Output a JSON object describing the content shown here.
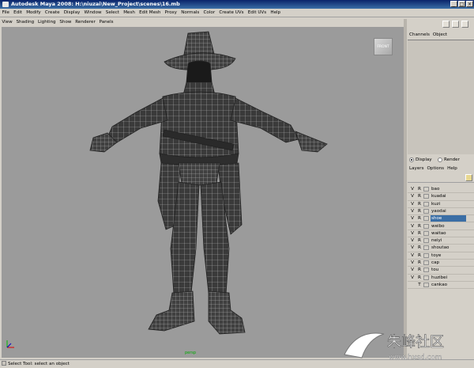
{
  "window": {
    "title": "Autodesk Maya 2008: H:\\niuzai\\New_Project\\scenes\\16.mb",
    "controls": [
      "_",
      "□",
      "×"
    ]
  },
  "menubar": [
    "File",
    "Edit",
    "Modify",
    "Create",
    "Display",
    "Window",
    "Select",
    "Mesh",
    "Edit Mesh",
    "Proxy",
    "Normals",
    "Color",
    "Create UVs",
    "Edit UVs",
    "Help"
  ],
  "panel_menu": [
    "View",
    "Shading",
    "Lighting",
    "Show",
    "Renderer",
    "Panels"
  ],
  "viewport": {
    "viewcube_label": "FRONT",
    "camera_label": "persp",
    "background": "#9b9b9b"
  },
  "channel_box": {
    "tabs": [
      "Channels",
      "Object"
    ]
  },
  "layer_editor": {
    "modes": [
      {
        "label": "Display",
        "selected": true
      },
      {
        "label": "Render",
        "selected": false
      }
    ],
    "menu": [
      "Layers",
      "Options",
      "Help"
    ],
    "layers": [
      {
        "v": "V",
        "r": "R",
        "name": "bao",
        "selected": false
      },
      {
        "v": "V",
        "r": "R",
        "name": "kuadai",
        "selected": false
      },
      {
        "v": "V",
        "r": "R",
        "name": "kuzi",
        "selected": false
      },
      {
        "v": "V",
        "r": "R",
        "name": "yaodai",
        "selected": false
      },
      {
        "v": "V",
        "r": "R",
        "name": "shoe",
        "selected": true
      },
      {
        "v": "V",
        "r": "R",
        "name": "weibo",
        "selected": false
      },
      {
        "v": "V",
        "r": "R",
        "name": "waitao",
        "selected": false
      },
      {
        "v": "V",
        "r": "R",
        "name": "neiyi",
        "selected": false
      },
      {
        "v": "V",
        "r": "R",
        "name": "shoutao",
        "selected": false
      },
      {
        "v": "V",
        "r": "R",
        "name": "toye",
        "selected": false
      },
      {
        "v": "V",
        "r": "R",
        "name": "cap",
        "selected": false
      },
      {
        "v": "V",
        "r": "R",
        "name": "tou",
        "selected": false
      },
      {
        "v": "V",
        "r": "R",
        "name": "huzibei",
        "selected": false
      },
      {
        "v": "",
        "r": "T",
        "name": "cankao",
        "selected": false
      }
    ]
  },
  "help_line": "Select Tool: select an object",
  "watermark": {
    "text": "朱峰社区",
    "url": "www.hxsd.com"
  },
  "colors": {
    "titlebar": "#0a246a",
    "selection": "#3a6ea5",
    "mesh": "#3a3a3a",
    "wire": "#bdbdbd"
  }
}
